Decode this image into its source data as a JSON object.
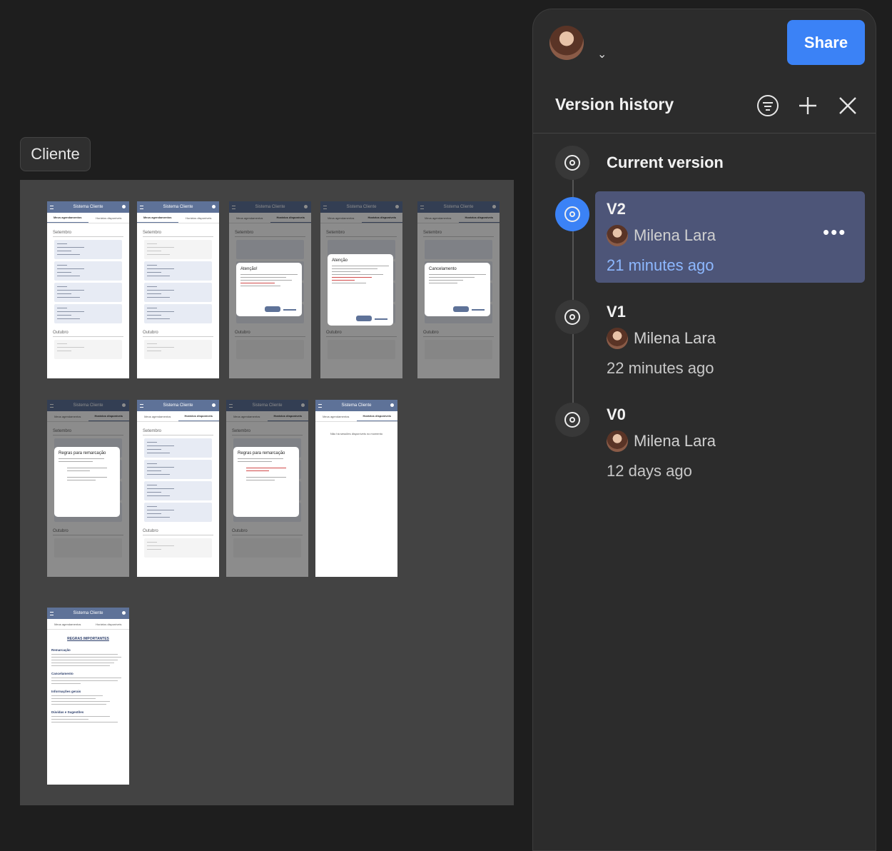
{
  "canvas": {
    "frame_label": "Cliente",
    "app_title": "Sistema Cliente",
    "tab_mine": "Meus agendamentos",
    "tab_available": "Horários disponíveis",
    "month_1": "Setembro",
    "month_2": "Outubro",
    "dialog_attention": "Atenção!",
    "dialog_attention_2": "Atenção",
    "dialog_cancel": "Cancelamento",
    "dialog_rules": "Regras para remarcação",
    "empty_message": "Não há sessões disponíveis no momento",
    "rules_title": "REGRAS IMPORTANTES",
    "rules_sections": [
      "Remarcação",
      "Cancelamento",
      "Informações gerais",
      "Dúvidas e Sugestões"
    ]
  },
  "panel": {
    "share_label": "Share",
    "title": "Version history",
    "icons": {
      "filter": "filter-icon",
      "add": "plus-icon",
      "close": "close-icon",
      "chevron": "chevron-down-icon"
    },
    "current_label": "Current version",
    "versions": [
      {
        "name": "V2",
        "user": "Milena Lara",
        "time": "21 minutes ago",
        "selected": true
      },
      {
        "name": "V1",
        "user": "Milena Lara",
        "time": "22 minutes ago",
        "selected": false
      },
      {
        "name": "V0",
        "user": "Milena Lara",
        "time": "12 days ago",
        "selected": false
      }
    ],
    "accent": "#3b82f6",
    "selected_bg": "#4d5578",
    "selected_time_color": "#8db8ff"
  }
}
